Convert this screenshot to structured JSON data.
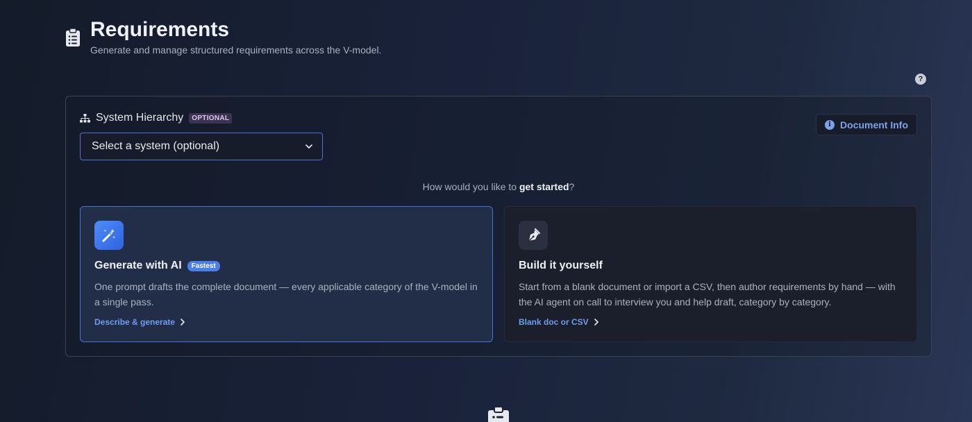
{
  "header": {
    "title": "Requirements",
    "subtitle": "Generate and manage structured requirements across the V-model.",
    "icon": "clipboard-list-icon"
  },
  "help": {
    "label": "?",
    "icon": "question-circle-icon"
  },
  "hierarchy": {
    "label": "System Hierarchy",
    "badge": "OPTIONAL",
    "icon": "sitemap-icon",
    "select_value": "Select a system (optional)"
  },
  "doc_info": {
    "label": "Document Info",
    "icon": "info-circle-icon",
    "glyph": "i"
  },
  "prompt": {
    "prefix": "How would you like to ",
    "strong": "get started",
    "suffix": "?"
  },
  "cards": [
    {
      "title": "Generate with AI",
      "badge": "Fastest",
      "description": "One prompt drafts the complete document — every applicable category of the V-model in a single pass.",
      "link": "Describe & generate",
      "icon": "magic-wand-icon"
    },
    {
      "title": "Build it yourself",
      "description": "Start from a blank document or import a CSV, then author requirements by hand — with the AI agent on call to interview you and help draft, category by category.",
      "link": "Blank doc or CSV",
      "icon": "pen-nib-icon"
    }
  ],
  "colors": {
    "accent": "#4b72d8",
    "link": "#6f9bf0",
    "badge_optional_bg": "#3b3350",
    "badge_fastest_bg": "#4b7ee8"
  }
}
